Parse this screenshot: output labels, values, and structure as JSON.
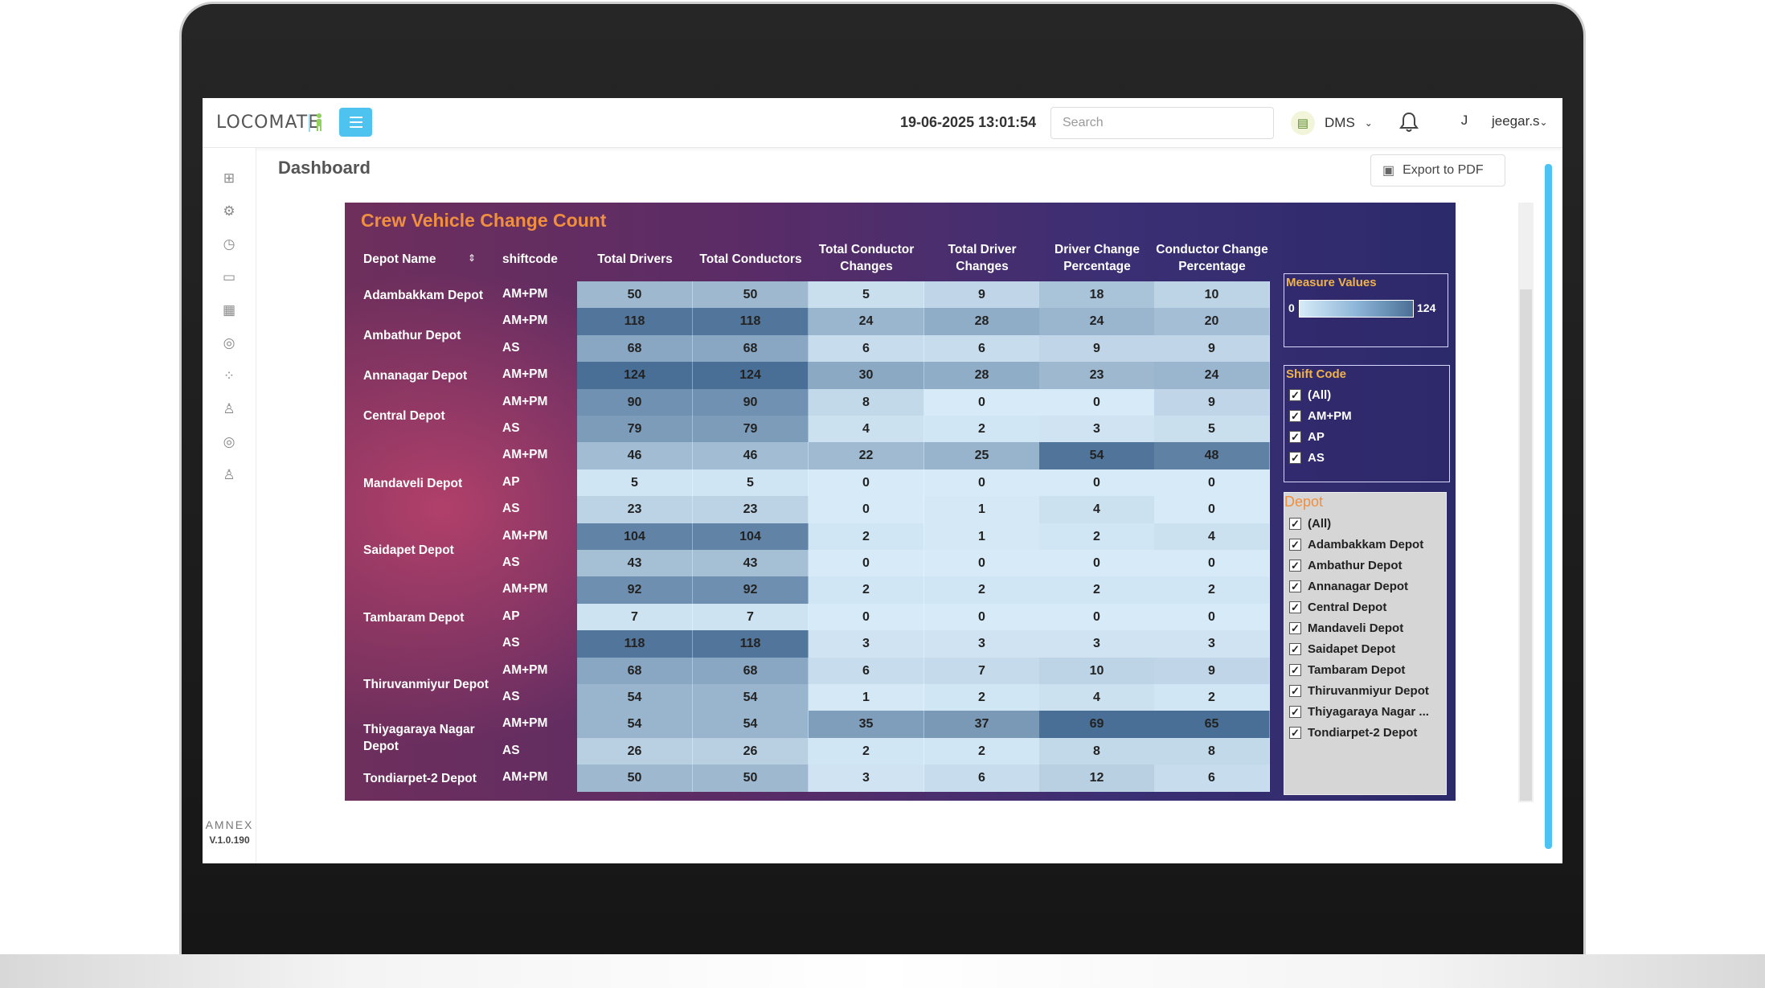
{
  "header": {
    "logo_text": "LOCOMATE",
    "datetime": "19-06-2025 13:01:54",
    "search_placeholder": "Search",
    "module": "DMS",
    "avatar_initial": "J",
    "username": "jeegar.s"
  },
  "sidebar": {
    "icons": [
      "dashboard-icon",
      "gear-icon",
      "clock-icon",
      "bus-icon",
      "report-icon",
      "route-search-icon",
      "location-pin-icon",
      "crew-icon",
      "crew-search-icon",
      "user-icon"
    ],
    "brand": "AMNEX",
    "version": "V.1.0.190"
  },
  "page": {
    "title": "Dashboard",
    "export_label": "Export to PDF"
  },
  "viz": {
    "title": "Crew Vehicle Change Count",
    "columns": [
      "Depot Name",
      "shiftcode",
      "Total Drivers",
      "Total Conductors",
      "Total Conductor Changes",
      "Total Driver Changes",
      "Driver Change Percentage",
      "Conductor Change Percentage"
    ],
    "depots": [
      {
        "name": "Adambakkam Depot",
        "rows": [
          0
        ]
      },
      {
        "name": "Ambathur Depot",
        "rows": [
          1,
          2
        ]
      },
      {
        "name": "Annanagar Depot",
        "rows": [
          3
        ]
      },
      {
        "name": "Central Depot",
        "rows": [
          4,
          5
        ]
      },
      {
        "name": "Mandaveli Depot",
        "rows": [
          6,
          7,
          8
        ]
      },
      {
        "name": "Saidapet Depot",
        "rows": [
          9,
          10
        ]
      },
      {
        "name": "Tambaram Depot",
        "rows": [
          11,
          12,
          13
        ]
      },
      {
        "name": "Thiruvanmiyur Depot",
        "rows": [
          14,
          15
        ]
      },
      {
        "name": "Thiyagaraya Nagar Depot",
        "rows": [
          16,
          17
        ]
      },
      {
        "name": "Tondiarpet-2 Depot",
        "rows": [
          18
        ]
      }
    ],
    "rows": [
      {
        "shift": "AM+PM",
        "values": [
          50,
          50,
          5,
          9,
          18,
          10
        ]
      },
      {
        "shift": "AM+PM",
        "values": [
          118,
          118,
          24,
          28,
          24,
          20
        ]
      },
      {
        "shift": "AS",
        "values": [
          68,
          68,
          6,
          6,
          9,
          9
        ]
      },
      {
        "shift": "AM+PM",
        "values": [
          124,
          124,
          30,
          28,
          23,
          24
        ]
      },
      {
        "shift": "AM+PM",
        "values": [
          90,
          90,
          8,
          0,
          0,
          9
        ]
      },
      {
        "shift": "AS",
        "values": [
          79,
          79,
          4,
          2,
          3,
          5
        ]
      },
      {
        "shift": "AM+PM",
        "values": [
          46,
          46,
          22,
          25,
          54,
          48
        ]
      },
      {
        "shift": "AP",
        "values": [
          5,
          5,
          0,
          0,
          0,
          0
        ]
      },
      {
        "shift": "AS",
        "values": [
          23,
          23,
          0,
          1,
          4,
          0
        ]
      },
      {
        "shift": "AM+PM",
        "values": [
          104,
          104,
          2,
          1,
          2,
          4
        ]
      },
      {
        "shift": "AS",
        "values": [
          43,
          43,
          0,
          0,
          0,
          0
        ]
      },
      {
        "shift": "AM+PM",
        "values": [
          92,
          92,
          2,
          2,
          2,
          2
        ]
      },
      {
        "shift": "AP",
        "values": [
          7,
          7,
          0,
          0,
          0,
          0
        ]
      },
      {
        "shift": "AS",
        "values": [
          118,
          118,
          3,
          3,
          3,
          3
        ]
      },
      {
        "shift": "AM+PM",
        "values": [
          68,
          68,
          6,
          7,
          10,
          9
        ]
      },
      {
        "shift": "AS",
        "values": [
          54,
          54,
          1,
          2,
          4,
          2
        ]
      },
      {
        "shift": "AM+PM",
        "values": [
          54,
          54,
          35,
          37,
          69,
          65
        ]
      },
      {
        "shift": "AS",
        "values": [
          26,
          26,
          2,
          2,
          8,
          8
        ]
      },
      {
        "shift": "AM+PM",
        "values": [
          50,
          50,
          3,
          6,
          12,
          6
        ]
      }
    ],
    "measure_legend": {
      "title": "Measure Values",
      "min": "0",
      "max": "124"
    },
    "shift_filter": {
      "title": "Shift Code",
      "options": [
        "(All)",
        "AM+PM",
        "AP",
        "AS"
      ]
    },
    "depot_filter": {
      "title": "Depot",
      "options": [
        "(All)",
        "Adambakkam Depot",
        "Ambathur Depot",
        "Annanagar Depot",
        "Central Depot",
        "Mandaveli Depot",
        "Saidapet Depot",
        "Tambaram Depot",
        "Thiruvanmiyur Depot",
        "Thiyagaraya Nagar ...",
        "Tondiarpet-2 Depot"
      ]
    }
  },
  "colors": {
    "accent": "#4fc3f0",
    "title_orange": "#ef8f3f",
    "legend_yellow": "#f0b24a"
  }
}
